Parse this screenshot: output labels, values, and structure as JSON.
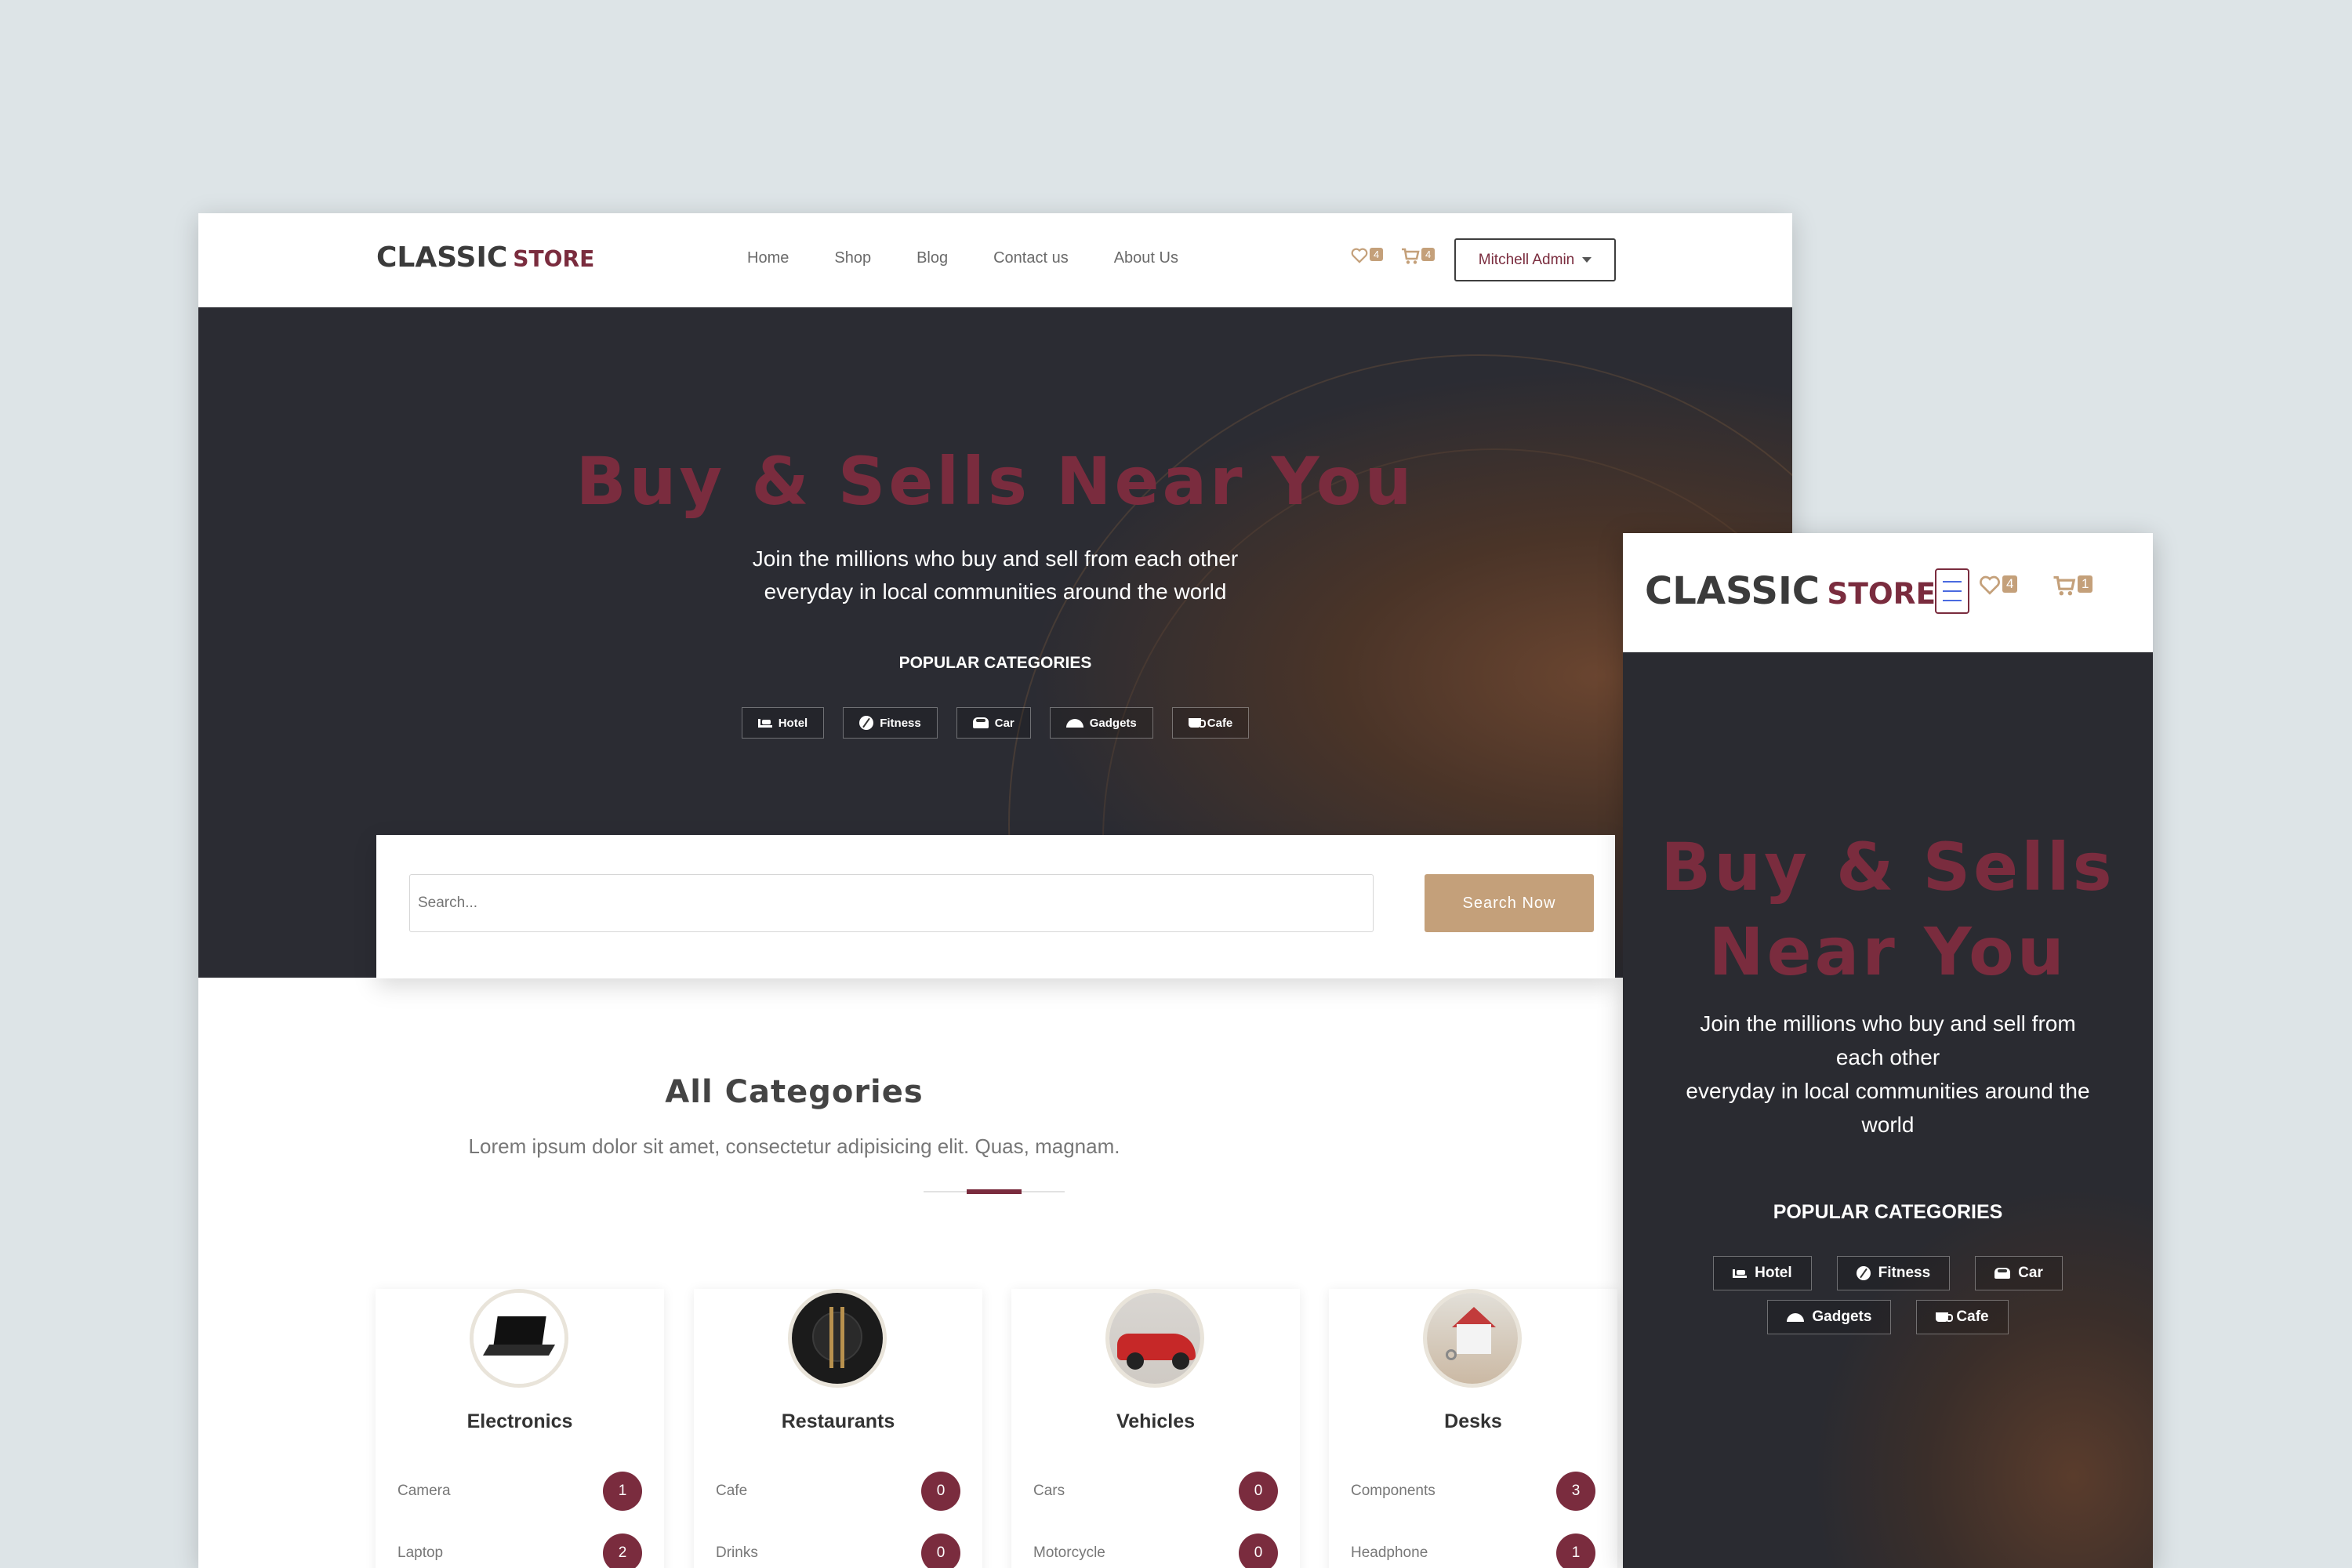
{
  "brand": {
    "word1": "CLASSIC",
    "word2": "STORE"
  },
  "nav": {
    "items": [
      "Home",
      "Shop",
      "Blog",
      "Contact us",
      "About Us"
    ]
  },
  "desktop": {
    "wishlist_count": "4",
    "cart_count": "4"
  },
  "mobile": {
    "wishlist_count": "4",
    "cart_count": "1"
  },
  "account": {
    "label": "Mitchell Admin"
  },
  "hero": {
    "title": "Buy & Sells Near You",
    "subtitle_line1": "Join the millions who buy and sell from each other",
    "subtitle_line2": "everyday in local communities around the world",
    "popular_title": "POPULAR CATEGORIES",
    "chips": [
      "Hotel",
      "Fitness",
      "Car",
      "Gadgets",
      "Cafe"
    ]
  },
  "mobile_hero": {
    "title_line1": "Buy & Sells",
    "title_line2": "Near You",
    "subtitle_line1": "Join the millions who buy and sell from",
    "subtitle_line2": "each other",
    "subtitle_line3": "everyday in local communities around the",
    "subtitle_line4": "world"
  },
  "search": {
    "placeholder": "Search...",
    "button": "Search Now"
  },
  "categories": {
    "title": "All Categories",
    "description": "Lorem ipsum dolor sit amet, consectetur adipisicing elit. Quas, magnam.",
    "cards": [
      {
        "name": "Electronics",
        "items": [
          {
            "label": "Camera",
            "count": "1"
          },
          {
            "label": "Laptop",
            "count": "2"
          }
        ]
      },
      {
        "name": "Restaurants",
        "items": [
          {
            "label": "Cafe",
            "count": "0"
          },
          {
            "label": "Drinks",
            "count": "0"
          }
        ]
      },
      {
        "name": "Vehicles",
        "items": [
          {
            "label": "Cars",
            "count": "0"
          },
          {
            "label": "Motorcycle",
            "count": "0"
          }
        ]
      },
      {
        "name": "Desks",
        "items": [
          {
            "label": "Components",
            "count": "3"
          },
          {
            "label": "Headphone",
            "count": "1"
          }
        ]
      }
    ]
  },
  "colors": {
    "accent": "#7a2c3e",
    "button": "#c4a07a",
    "background": "#dde4e7"
  }
}
